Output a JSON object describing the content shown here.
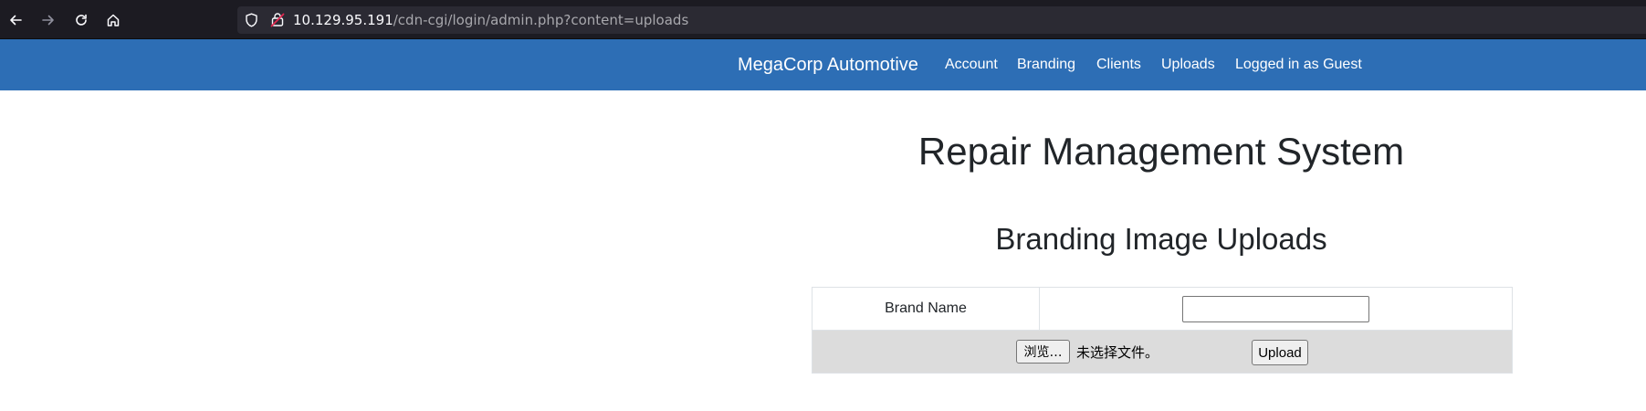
{
  "browser": {
    "url_host": "10.129.95.191",
    "url_path": "/cdn-cgi/login/admin.php?content=uploads"
  },
  "navbar": {
    "brand": "MegaCorp Automotive",
    "links": [
      "Account",
      "Branding",
      "Clients",
      "Uploads",
      "Logged in as Guest"
    ],
    "background_color": "#2d6eb5"
  },
  "main": {
    "title": "Repair Management System",
    "section_title": "Branding Image Uploads"
  },
  "form": {
    "brand_name_label": "Brand Name",
    "brand_name_value": "",
    "browse_label": "浏览…",
    "file_status": "未选择文件。",
    "upload_label": "Upload"
  },
  "icons": {
    "back": "back-arrow-icon",
    "forward": "forward-arrow-icon",
    "reload": "reload-icon",
    "home": "home-icon",
    "shield": "shield-icon",
    "lock": "insecure-lock-icon"
  }
}
